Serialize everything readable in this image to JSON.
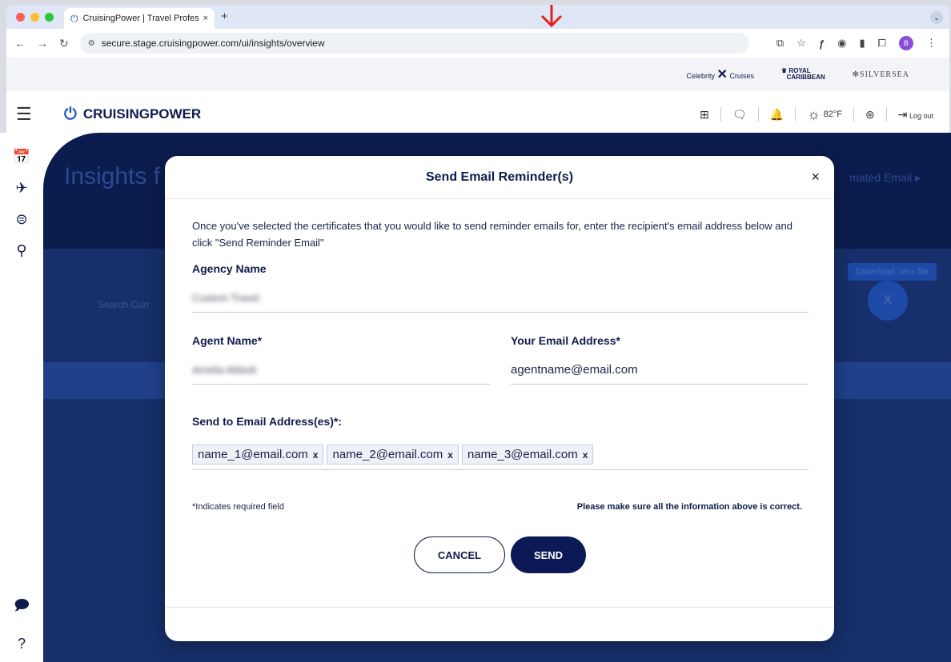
{
  "browser": {
    "tab_title": "CruisingPower | Travel Profes",
    "tab_close": "×",
    "new_tab": "+",
    "url": "secure.stage.cruisingpower.com/ui/insights/overview",
    "profile_initial": "B"
  },
  "brands": {
    "celebrity": "Celebrity",
    "celebrity_suffix": "Cruises",
    "royal_line1": "ROYAL",
    "royal_line2": "CARIBBEAN",
    "silversea": "SILVERSEA"
  },
  "header": {
    "logo_text": "CRUISINGPOWER",
    "temperature": "82°F",
    "logout": "Log out"
  },
  "background": {
    "title": "Insights f",
    "automated": "mated Email ▸",
    "search": "Search Curr",
    "download": "Download .xlsx file",
    "x_badge": "X"
  },
  "modal": {
    "title": "Send Email Reminder(s)",
    "close": "×",
    "intro": "Once you've selected the certificates that you would like to send reminder emails for, enter the recipient's email address below and click \"Send Reminder Email\"",
    "agency_label": "Agency Name",
    "agency_value": "Custom Travel",
    "agent_label": "Agent Name*",
    "agent_value": "Amelia Abbott",
    "email_label": "Your Email Address*",
    "email_value": "agentname@email.com",
    "send_to_label": "Send to Email Address(es)*:",
    "chips": [
      "name_1@email.com",
      "name_2@email.com",
      "name_3@email.com"
    ],
    "chip_remove": "x",
    "required_note": "*Indicates required field",
    "confirm_note": "Please make sure all the information above is correct.",
    "cancel": "CANCEL",
    "send": "SEND"
  }
}
